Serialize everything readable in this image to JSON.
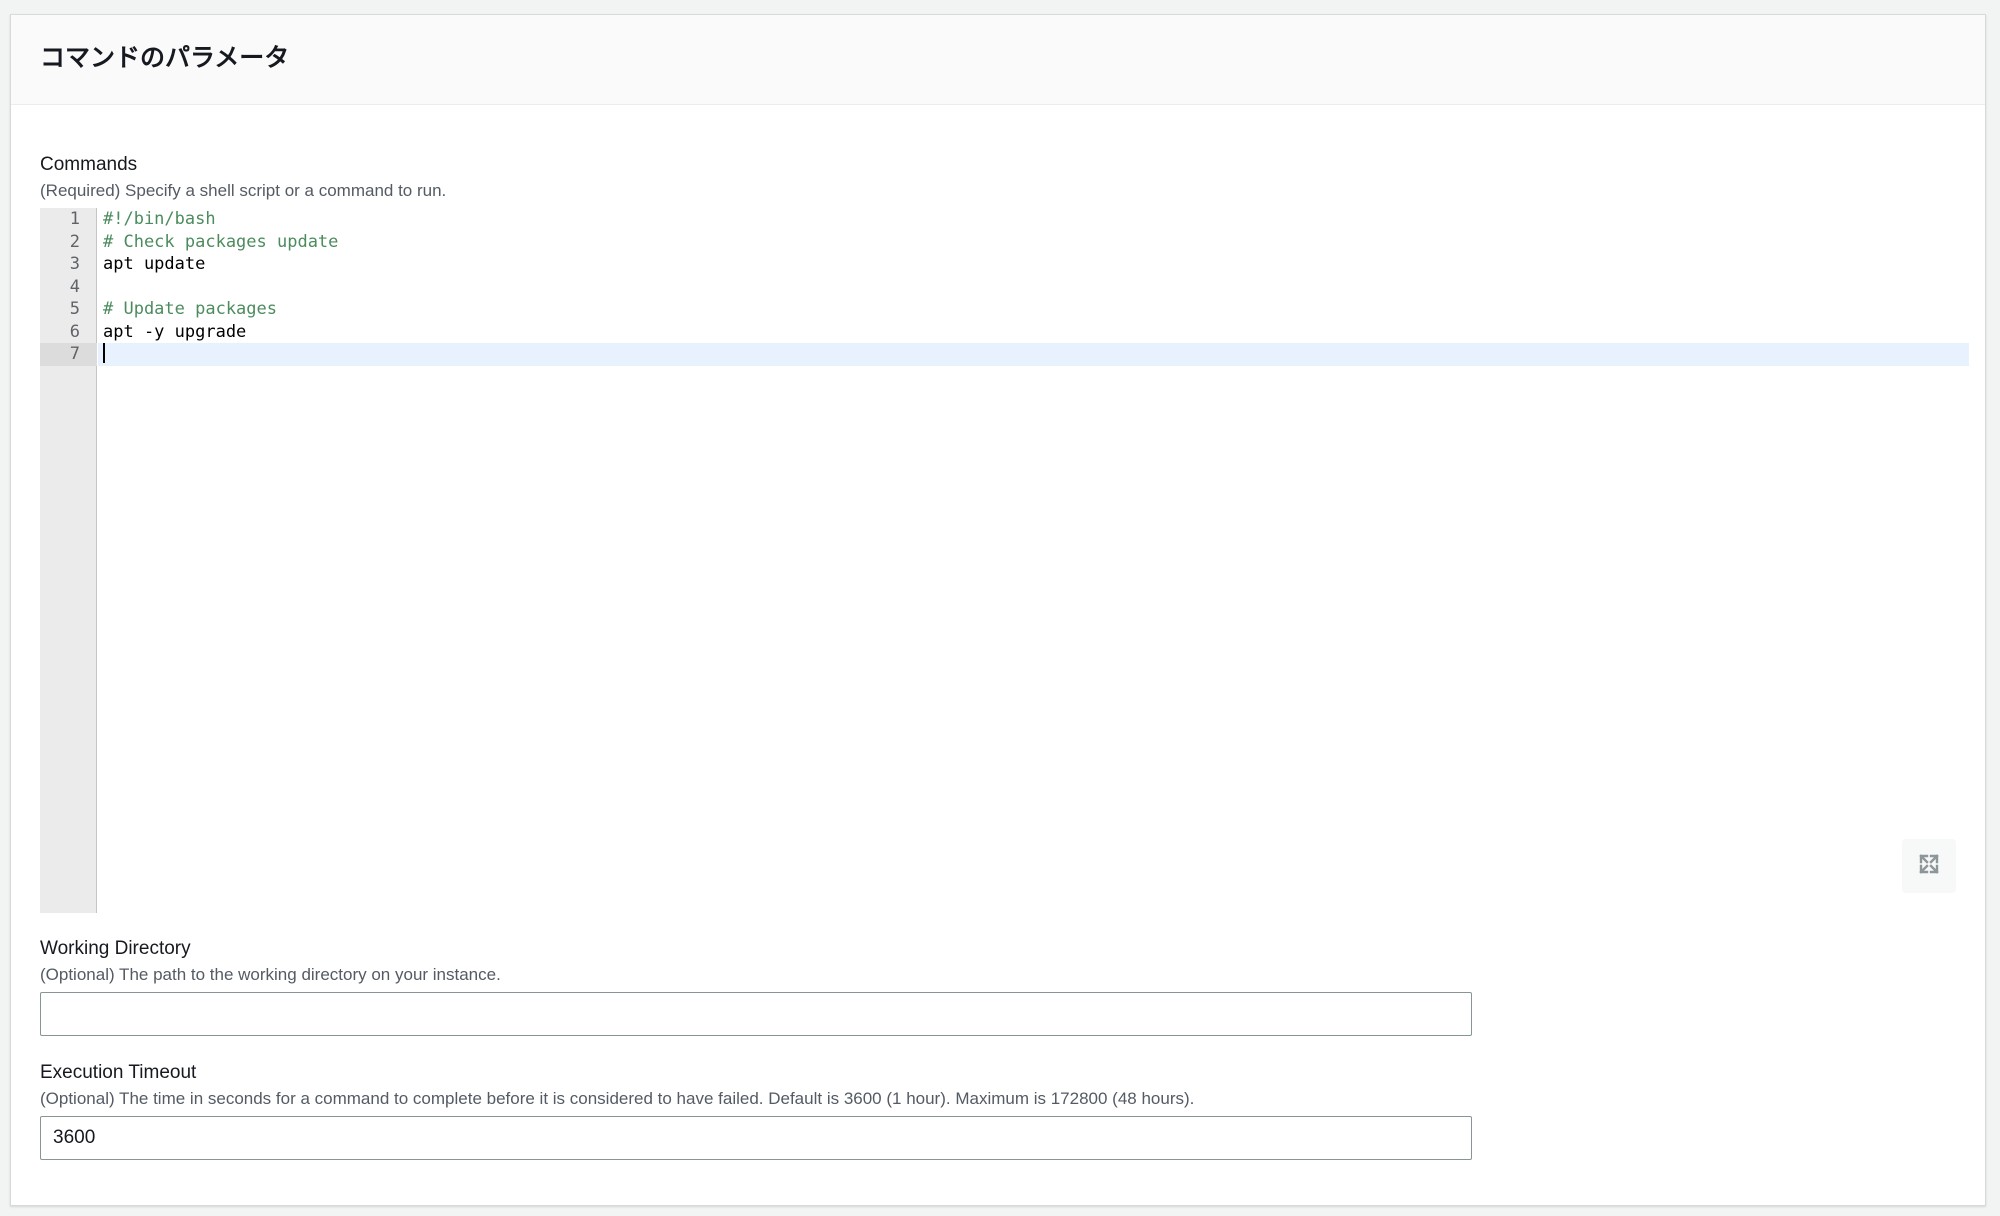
{
  "panel": {
    "title": "コマンドのパラメータ"
  },
  "commands": {
    "label": "Commands",
    "description": "(Required) Specify a shell script or a command to run.",
    "lines": [
      {
        "num": "1",
        "text": "#!/bin/bash"
      },
      {
        "num": "2",
        "text": "# Check packages update"
      },
      {
        "num": "3",
        "text": "apt update"
      },
      {
        "num": "4",
        "text": ""
      },
      {
        "num": "5",
        "text": "# Update packages"
      },
      {
        "num": "6",
        "text": "apt -y upgrade"
      },
      {
        "num": "7",
        "text": ""
      }
    ],
    "expand_icon": "expand-icon"
  },
  "working_directory": {
    "label": "Working Directory",
    "description": "(Optional) The path to the working directory on your instance.",
    "value": "",
    "placeholder": ""
  },
  "execution_timeout": {
    "label": "Execution Timeout",
    "description": "(Optional) The time in seconds for a command to complete before it is considered to have failed. Default is 3600 (1 hour). Maximum is 172800 (48 hours).",
    "value": "3600"
  },
  "colors": {
    "comment": "#4c8b5e",
    "active_line": "#e8f2fe",
    "gutter": "#ebebeb"
  }
}
